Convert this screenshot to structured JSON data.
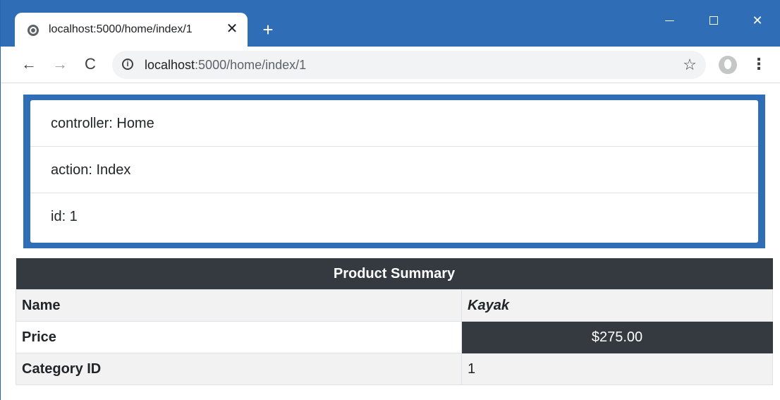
{
  "browser": {
    "tab_title": "localhost:5000/home/index/1",
    "tab_close": "✕",
    "new_tab": "+",
    "window_close": "✕",
    "nav": {
      "back": "←",
      "forward": "→",
      "reload": "C"
    },
    "address": {
      "host": "localhost",
      "path": ":5000/home/index/1",
      "info": "i"
    },
    "star": "☆",
    "menu": "⋮"
  },
  "route_values": [
    {
      "text": "controller: Home"
    },
    {
      "text": "action: Index"
    },
    {
      "text": "id: 1"
    }
  ],
  "summary": {
    "title": "Product Summary",
    "rows": [
      {
        "label": "Name",
        "value": "Kayak"
      },
      {
        "label": "Price",
        "value": "$275.00"
      },
      {
        "label": "Category ID",
        "value": "1"
      }
    ]
  },
  "colors": {
    "title_bar": "#2f6db6",
    "route_panel_border": "#2f6db6",
    "table_dark": "#343a40",
    "table_stripe": "#f2f2f2"
  },
  "icons": {
    "favicon": "globe-icon",
    "info": "info-icon",
    "star": "star-icon",
    "profile": "profile-icon",
    "menu": "kebab-menu-icon"
  }
}
